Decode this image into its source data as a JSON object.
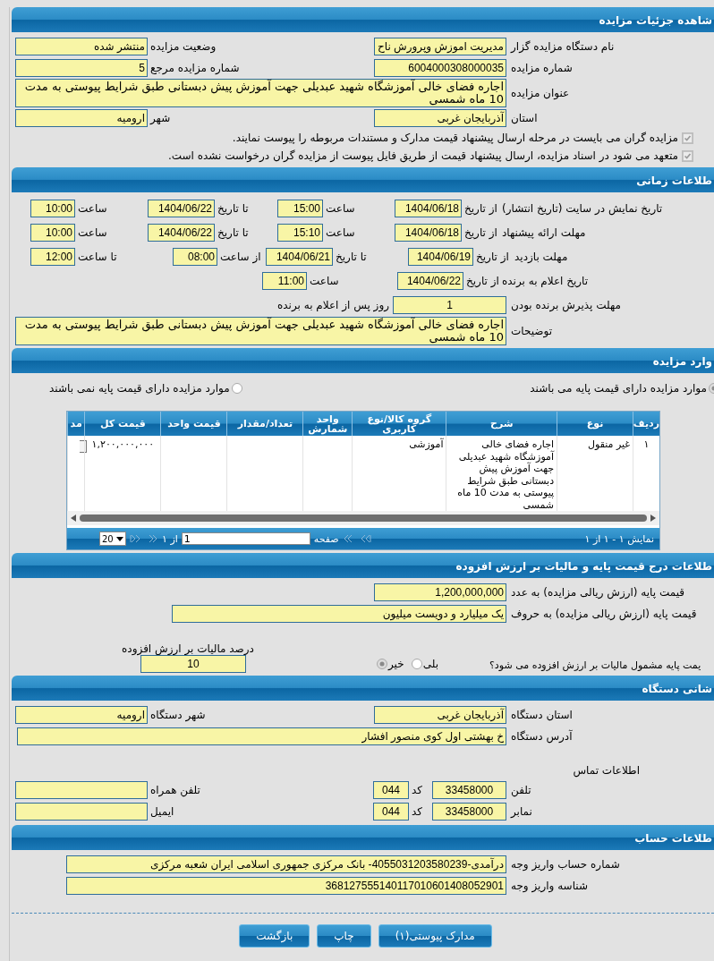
{
  "sections": [
    {
      "title": "شاهده جزئیات مزایده",
      "rows": [
        {
          "kind": "pair",
          "cells": [
            {
              "kind": "label",
              "text": "نام دستگاه مزایده گزار"
            },
            {
              "kind": "field",
              "text": "مدیریت اموزش وپرورش ناح"
            },
            {
              "kind": "label",
              "text": "وضعیت مزایده"
            },
            {
              "kind": "field",
              "text": "منتشر شده"
            }
          ]
        },
        {
          "kind": "pair",
          "cells": [
            {
              "kind": "label",
              "text": "شماره مزایده"
            },
            {
              "kind": "field",
              "text": "6004000308000035"
            },
            {
              "kind": "label",
              "text": "شماره مزایده مرجع"
            },
            {
              "kind": "field",
              "text": "5"
            }
          ]
        },
        {
          "kind": "area",
          "cells": [
            {
              "kind": "label",
              "text": "عنوان مزایده"
            },
            {
              "kind": "area",
              "text": "اجاره فضای خالی آموزشگاه شهید عبدیلی جهت آموزش پیش دبستانی طبق شرایط پیوستی به مدت 10 ماه شمسی"
            }
          ]
        },
        {
          "kind": "pair",
          "cells": [
            {
              "kind": "label",
              "text": "استان"
            },
            {
              "kind": "field",
              "text": "آذربایجان غربی"
            },
            {
              "kind": "label",
              "text": "شهر"
            },
            {
              "kind": "field",
              "text": "ارومیه"
            }
          ]
        },
        {
          "kind": "check",
          "label": "مزایده گران می بایست در مرحله ارسال پیشنهاد قیمت مدارک و مستندات مربوطه را پیوست نمایند.",
          "checked": true
        },
        {
          "kind": "check",
          "label": "متعهد می شود در اسناد مزایده، ارسال پیشنهاد قیمت از طریق فایل پیوست از مزایده گران درخواست نشده است.",
          "checked": true
        }
      ]
    },
    {
      "title": "طلاعات زمانی",
      "rows": [
        {
          "kind": "range",
          "cells": [
            {
              "kind": "label",
              "text": "تاریخ نمایش در سایت (تاریخ انتشار)"
            },
            {
              "kind": "label",
              "text": "از تاریخ"
            },
            {
              "kind": "field",
              "text": "1404/06/18"
            },
            {
              "kind": "label",
              "text": "ساعت"
            },
            {
              "kind": "field",
              "text": "15:00"
            },
            {
              "kind": "label",
              "text": "تا تاریخ"
            },
            {
              "kind": "field",
              "text": "1404/06/22"
            },
            {
              "kind": "label",
              "text": "ساعت"
            },
            {
              "kind": "field",
              "text": "10:00"
            }
          ]
        },
        {
          "kind": "range",
          "cells": [
            {
              "kind": "label",
              "text": "مهلت ارائه پیشنهاد"
            },
            {
              "kind": "label",
              "text": "از تاریخ"
            },
            {
              "kind": "field",
              "text": "1404/06/18"
            },
            {
              "kind": "label",
              "text": "ساعت"
            },
            {
              "kind": "field",
              "text": "15:10"
            },
            {
              "kind": "label",
              "text": "تا تاریخ"
            },
            {
              "kind": "field",
              "text": "1404/06/22"
            },
            {
              "kind": "label",
              "text": "ساعت"
            },
            {
              "kind": "field",
              "text": "10:00"
            }
          ]
        },
        {
          "kind": "visit",
          "cells": [
            {
              "kind": "label",
              "text": "مهلت بازدید"
            },
            {
              "kind": "label",
              "text": "از تاریخ"
            },
            {
              "kind": "field",
              "text": "1404/06/19"
            },
            {
              "kind": "label",
              "text": "تا تاریخ"
            },
            {
              "kind": "field",
              "text": "1404/06/21"
            },
            {
              "kind": "label",
              "text": "از ساعت"
            },
            {
              "kind": "field",
              "text": "08:00"
            },
            {
              "kind": "label",
              "text": "تا ساعت"
            },
            {
              "kind": "field",
              "text": "12:00"
            }
          ]
        },
        {
          "kind": "single",
          "cells": [
            {
              "kind": "label",
              "text": "تاریخ اعلام به برنده"
            },
            {
              "kind": "label",
              "text": "از تاریخ"
            },
            {
              "kind": "field",
              "text": "1404/06/22"
            },
            {
              "kind": "label",
              "text": "ساعت"
            },
            {
              "kind": "field",
              "text": "11:00"
            }
          ]
        },
        {
          "kind": "days",
          "cells": [
            {
              "kind": "label",
              "text": "مهلت پذیرش برنده بودن"
            },
            {
              "kind": "field",
              "text": "1"
            }
          ],
          "note": "روز پس از اعلام به برنده"
        },
        {
          "kind": "note",
          "cells": [
            {
              "kind": "label",
              "text": "توضیحات"
            },
            {
              "kind": "area",
              "text": "اجاره فضای خالی آموزشگاه شهید عبدیلی جهت آموزش پیش دبستانی طبق شرایط پیوستی به مدت 10 ماه شمسی"
            }
          ]
        }
      ]
    },
    {
      "title": "وارد مزایده",
      "rows": [
        {
          "kind": "radios",
          "options": [
            {
              "label": "موارد مزایده دارای قیمت پایه می باشند",
              "selected": true
            },
            {
              "label": "موارد مزایده دارای قیمت پایه نمی باشند",
              "selected": false
            }
          ]
        },
        {
          "kind": "table",
          "columns": [
            "ردیف",
            "نوع",
            "شرح",
            "گروه کالا/نوع کاربری",
            "واحد شمارش",
            "تعداد/مقدار",
            "قیمت واحد",
            "قیمت کل",
            "مد"
          ],
          "rows": [
            {
              "cells": [
                {
                  "kind": "text",
                  "text": "١"
                },
                {
                  "kind": "text",
                  "text": "غیر منقول"
                },
                {
                  "kind": "text",
                  "text": "اجاره فضای خالی آموزشگاه شهید عبدیلی جهت آموزش پیش دبستانی طبق شرایط پیوستی به مدت 10 ماه شمسی"
                },
                {
                  "kind": "text",
                  "text": "آموزشی"
                },
                {
                  "kind": "empty"
                },
                {
                  "kind": "empty"
                },
                {
                  "kind": "empty"
                },
                {
                  "kind": "text",
                  "text": "١,٢٠٠,٠٠٠,٠٠٠"
                },
                {
                  "kind": "control"
                }
              ]
            }
          ],
          "pager": {
            "summary": "نمایش ١ - ١ از ١",
            "page_label": "صفحه",
            "page": "1",
            "of": "از ١",
            "page_size": "20"
          }
        }
      ]
    },
    {
      "title": "طلاعات درج قیمت پایه و مالیات بر ارزش افزوده",
      "rows": [
        {
          "kind": "price",
          "cells": [
            {
              "kind": "label",
              "text": "قیمت پایه (ارزش ریالی مزایده) به عدد"
            },
            {
              "kind": "field",
              "text": "1,200,000,000"
            }
          ]
        },
        {
          "kind": "words",
          "cells": [
            {
              "kind": "label",
              "text": "قیمت پایه (ارزش ریالی مزایده) به حروف"
            },
            {
              "kind": "field",
              "text": "یک میلیارد و دویست میلیون"
            }
          ]
        },
        {
          "kind": "vat",
          "question": "یمت پایه مشمول مالیات بر ارزش افزوده می شود؟",
          "options": [
            {
              "label": "بلی",
              "selected": false
            },
            {
              "label": "خیر",
              "selected": true
            }
          ],
          "rate_label": "درصد مالیات بر ارزش افزوده",
          "rate": "10"
        }
      ]
    },
    {
      "title": "شانی دستگاه",
      "rows": [
        {
          "kind": "pair",
          "cells": [
            {
              "kind": "label",
              "text": "استان دستگاه"
            },
            {
              "kind": "field",
              "text": "آذربایجان غربی"
            },
            {
              "kind": "label",
              "text": "شهر دستگاه"
            },
            {
              "kind": "field",
              "text": "ارومیه"
            }
          ]
        },
        {
          "kind": "address",
          "cells": [
            {
              "kind": "label",
              "text": "آدرس دستگاه"
            },
            {
              "kind": "field",
              "text": "خ بهشتی اول کوی منصور افشار"
            }
          ]
        },
        {
          "kind": "caption",
          "text": "اطلاعات تماس"
        },
        {
          "kind": "contact",
          "cells": [
            {
              "kind": "label",
              "text": "تلفن"
            },
            {
              "kind": "field",
              "text": "33458000"
            },
            {
              "kind": "label",
              "text": "کد"
            },
            {
              "kind": "field",
              "text": "044"
            },
            {
              "kind": "label",
              "text": "تلفن همراه"
            },
            {
              "kind": "field"
            }
          ]
        },
        {
          "kind": "contact",
          "cells": [
            {
              "kind": "label",
              "text": "نمابر"
            },
            {
              "kind": "field",
              "text": "33458000"
            },
            {
              "kind": "label",
              "text": "کد"
            },
            {
              "kind": "field",
              "text": "044"
            },
            {
              "kind": "label",
              "text": "ایمیل"
            },
            {
              "kind": "field"
            }
          ]
        }
      ]
    },
    {
      "title": "طلاعات حساب",
      "rows": [
        {
          "kind": "account",
          "cells": [
            {
              "kind": "label",
              "text": "شماره حساب واریز وجه"
            },
            {
              "kind": "field",
              "text": "درآمدی-4055031203580239- بانک مرکزی جمهوری اسلامی ایران شعبه مرکزی"
            }
          ]
        },
        {
          "kind": "account",
          "cells": [
            {
              "kind": "label",
              "text": "شناسه واریز وجه"
            },
            {
              "kind": "field",
              "text": "368127555140117010601408052901"
            }
          ]
        }
      ]
    }
  ],
  "buttons": [
    "مدارک پیوستی(١)",
    "چاپ",
    "بازگشت"
  ]
}
